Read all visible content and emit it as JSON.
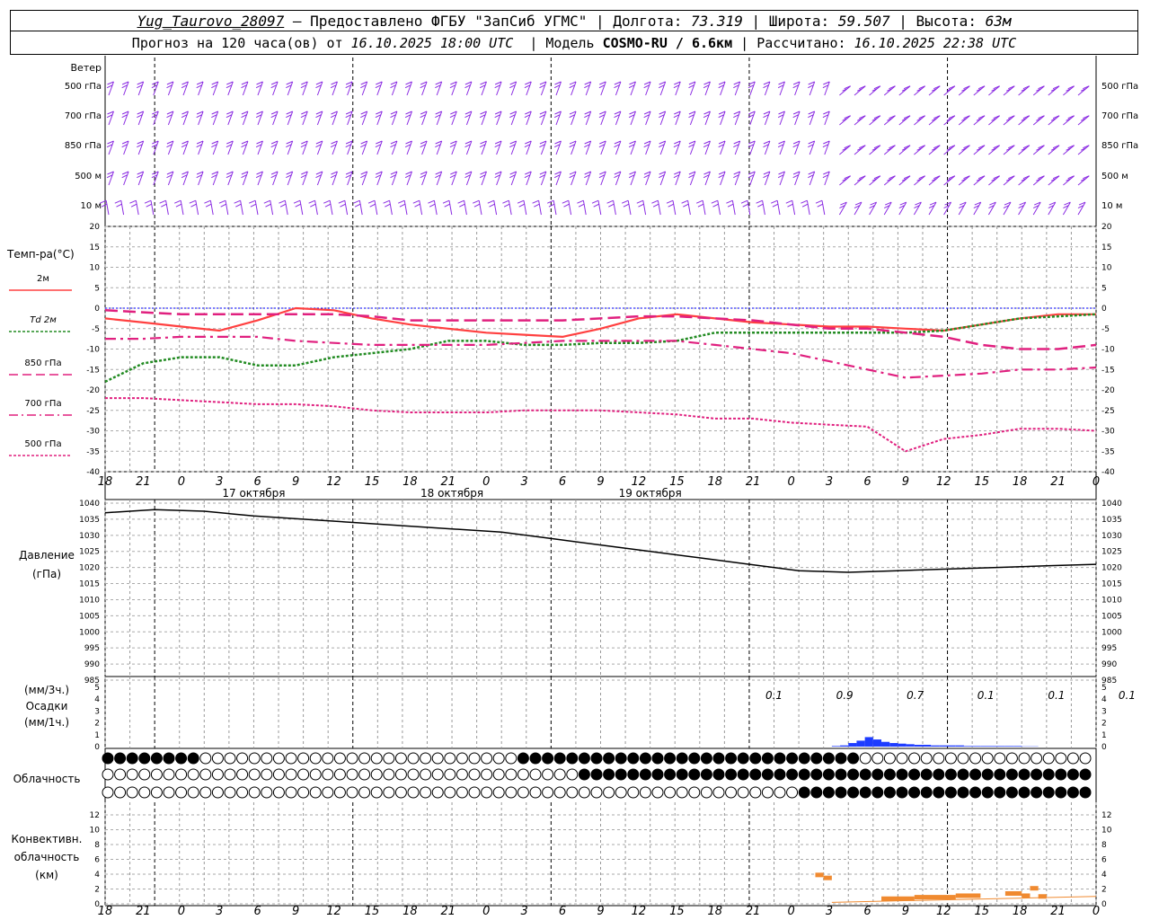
{
  "header": {
    "station": "Yug_Taurovo_28097",
    "provided": "– Предоставлено ФГБУ \"ЗапСиб УГМС\"",
    "lon_label": "Долгота:",
    "lon": "73.319",
    "lat_label": "Широта:",
    "lat": "59.507",
    "alt_label": "Высота:",
    "alt": "63м",
    "forecast_label": "Прогноз на 120 часа(ов) от",
    "forecast_time": "16.10.2025 18:00 UTC",
    "model_label": "Модель",
    "model": "COSMO-RU / 6.6км",
    "calc_label": "Рассчитано:",
    "calc_time": "16.10.2025 22:38 UTC"
  },
  "colors": {
    "wind": "#8a2be2",
    "t2m": "#ff4040",
    "td2m": "#228b22",
    "t850": "#e0207f",
    "t700": "#e0207f",
    "t500": "#e0207f",
    "zero": "#0000ff",
    "precip": "#1e3cff",
    "conv": "#f08a30"
  },
  "wind_panel": {
    "title": "Ветер",
    "levels": [
      "500 гПа",
      "700 гПа",
      "850 гПа",
      "500 м",
      "10  м"
    ]
  },
  "temp_panel": {
    "title": "Темп-ра(°C)",
    "legend": [
      "2м",
      "Td  2м",
      "850 гПа",
      "700 гПа",
      "500 гПа"
    ]
  },
  "pressure_panel": {
    "title": "Давление",
    "unit": "(гПа)"
  },
  "precip_panel": {
    "unit1": "(мм/3ч.)",
    "title": "Осадки",
    "unit2": "(мм/1ч.)",
    "labels": [
      "0.1",
      "0.9",
      "0.7",
      "0.1",
      "0.1",
      "0.1"
    ]
  },
  "cloud_panel": {
    "title": "Облачность"
  },
  "conv_panel": {
    "title1": "Конвективн.",
    "title2": "облачность",
    "unit": "(км)"
  },
  "axis": {
    "hour_labels": [
      "18",
      "21",
      "0",
      "3",
      "6",
      "9",
      "12",
      "15",
      "18",
      "21",
      "0",
      "3",
      "6",
      "9",
      "12",
      "15",
      "18",
      "21",
      "0",
      "3",
      "6",
      "9",
      "12",
      "15",
      "18",
      "21",
      "0"
    ],
    "day_labels": [
      "17 октября",
      "18 октября",
      "19 октября"
    ]
  },
  "chart_data": [
    {
      "type": "line",
      "name": "temperature",
      "x_hours": [
        0,
        3,
        6,
        9,
        12,
        15,
        18,
        21,
        24,
        27,
        30,
        33,
        36,
        39,
        42,
        45,
        48,
        51,
        54,
        57,
        60,
        63,
        66,
        69,
        72,
        75,
        78
      ],
      "series": [
        {
          "name": "2м",
          "values": [
            -2.5,
            -3.5,
            -4.5,
            -5.5,
            -3,
            0,
            -0.5,
            -2.5,
            -4,
            -5,
            -6,
            -6.5,
            -7,
            -5,
            -2.5,
            -1.5,
            -2.5,
            -3.5,
            -4,
            -4.5,
            -4.5,
            -5,
            -5.5,
            -4,
            -2.5,
            -1.5,
            -1.5
          ]
        },
        {
          "name": "Td  2м",
          "values": [
            -18,
            -13.5,
            -12,
            -12,
            -14,
            -14,
            -12,
            -11,
            -10,
            -8,
            -8,
            -9,
            -9,
            -8.5,
            -8.5,
            -8,
            -6,
            -6,
            -6,
            -6,
            -6,
            -6,
            -5.5,
            -4,
            -2.5,
            -2,
            -1.5
          ]
        },
        {
          "name": "850 гПа",
          "values": [
            -0.5,
            -1,
            -1.5,
            -1.5,
            -1.5,
            -1.5,
            -1.5,
            -2,
            -3,
            -3,
            -3,
            -3,
            -3,
            -2.5,
            -2,
            -2,
            -2.5,
            -3,
            -4,
            -5,
            -5,
            -6,
            -7,
            -9,
            -10,
            -10,
            -9
          ]
        },
        {
          "name": "700 гПа",
          "values": [
            -7.5,
            -7.5,
            -7,
            -7,
            -7,
            -8,
            -8.5,
            -9,
            -9,
            -9,
            -9,
            -8.5,
            -8,
            -8,
            -8,
            -8,
            -9,
            -10,
            -11,
            -13,
            -15,
            -17,
            -16.5,
            -16,
            -15,
            -15,
            -14.5
          ]
        },
        {
          "name": "500 гПа",
          "values": [
            -22,
            -22,
            -22.5,
            -23,
            -23.5,
            -23.5,
            -24,
            -25,
            -25.5,
            -25.5,
            -25.5,
            -25,
            -25,
            -25,
            -25.5,
            -26,
            -27,
            -27,
            -28,
            -28.5,
            -29,
            -35,
            -32,
            -31,
            -29.5,
            -29.5,
            -30
          ]
        }
      ],
      "ylim": [
        -40,
        20
      ],
      "zero_line": 0
    },
    {
      "type": "line",
      "name": "pressure",
      "x_hours": [
        0,
        6,
        12,
        18,
        24,
        30,
        36,
        42,
        48,
        54,
        60,
        66,
        72,
        78,
        84,
        90,
        96,
        102,
        108,
        114,
        120
      ],
      "values": [
        1037,
        1038,
        1037.5,
        1036,
        1035,
        1034,
        1033,
        1032,
        1031,
        1029,
        1027,
        1025,
        1023,
        1021,
        1019,
        1018.5,
        1019,
        1019.5,
        1020,
        1020.5,
        1021
      ],
      "ylim": [
        985,
        1040
      ]
    },
    {
      "type": "bar",
      "name": "precipitation",
      "x_hours": [
        88,
        89,
        90,
        91,
        92,
        93,
        94,
        95,
        96,
        97,
        98,
        99,
        100,
        101,
        102,
        103,
        104,
        105,
        106,
        107,
        108,
        109,
        110,
        111,
        112
      ],
      "values": [
        0.05,
        0.1,
        0.3,
        0.5,
        0.8,
        0.6,
        0.4,
        0.3,
        0.25,
        0.2,
        0.15,
        0.15,
        0.1,
        0.1,
        0.1,
        0.1,
        0.05,
        0.05,
        0.05,
        0.05,
        0.05,
        0.05,
        0.05,
        0.02,
        0.02
      ],
      "ylim": [
        0,
        5
      ]
    },
    {
      "type": "bar",
      "name": "convective_cloud",
      "segments": [
        {
          "x": [
            86,
            87
          ],
          "top": 4.2
        },
        {
          "x": [
            87,
            88
          ],
          "top": 3.8
        },
        {
          "x": [
            94,
            98
          ],
          "top": 1.0
        },
        {
          "x": [
            98,
            103
          ],
          "top": 1.2
        },
        {
          "x": [
            103,
            106
          ],
          "top": 1.4
        },
        {
          "x": [
            109,
            111
          ],
          "top": 1.7
        },
        {
          "x": [
            111,
            112
          ],
          "top": 1.4
        },
        {
          "x": [
            112,
            113
          ],
          "top": 2.4
        },
        {
          "x": [
            113,
            114
          ],
          "top": 1.3
        }
      ],
      "ylim": [
        0,
        12
      ]
    }
  ]
}
